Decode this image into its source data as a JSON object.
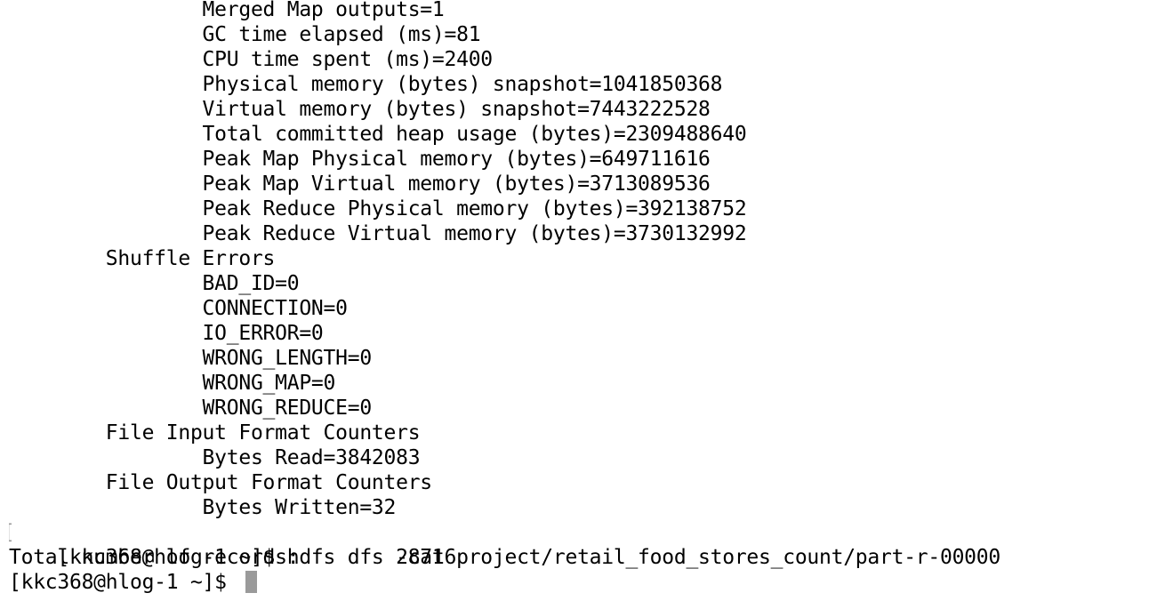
{
  "terminal": {
    "lines": [
      "                Merged Map outputs=1",
      "                GC time elapsed (ms)=81",
      "                CPU time spent (ms)=2400",
      "                Physical memory (bytes) snapshot=1041850368",
      "                Virtual memory (bytes) snapshot=7443222528",
      "                Total committed heap usage (bytes)=2309488640",
      "                Peak Map Physical memory (bytes)=649711616",
      "                Peak Map Virtual memory (bytes)=3713089536",
      "                Peak Reduce Physical memory (bytes)=392138752",
      "                Peak Reduce Virtual memory (bytes)=3730132992",
      "        Shuffle Errors",
      "                BAD_ID=0",
      "                CONNECTION=0",
      "                IO_ERROR=0",
      "                WRONG_LENGTH=0",
      "                WRONG_MAP=0",
      "                WRONG_REDUCE=0",
      "        File Input Format Counters",
      "                Bytes Read=3842083",
      "        File Output Format Counters",
      "                Bytes Written=32",
      "[kkc368@hlog-1 ~]$ hdfs dfs -cat project/retail_food_stores_count/part-r-00000",
      "Total number of records:        28716",
      "[kkc368@hlog-1 ~]$ "
    ],
    "marker_glyph": "[",
    "colors": {
      "background": "#ffffff",
      "text": "#000000",
      "cursor": "#9a9a9a",
      "marker": "#9a9a9a"
    }
  }
}
